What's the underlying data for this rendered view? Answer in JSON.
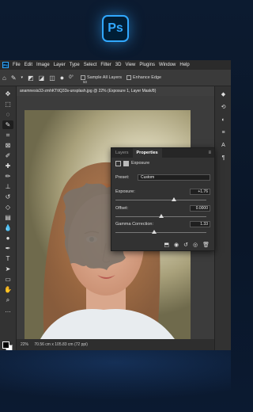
{
  "badge": {
    "logo_text": "Ps"
  },
  "menubar": {
    "logo_text": "Ps",
    "items": [
      "File",
      "Edit",
      "Image",
      "Layer",
      "Type",
      "Select",
      "Filter",
      "3D",
      "View",
      "Plugins",
      "Window",
      "Help"
    ]
  },
  "options": {
    "brush_size": "50",
    "angle": "0°",
    "sample_all_layers": "Sample All Layers",
    "enhance_edge": "Enhance Edge"
  },
  "document": {
    "tab_title": "anamnesis33-zmhKTtIQ33s-unsplash.jpg @ 22% (Exposure 1, Layer Mask/8)",
    "zoom": "22%",
    "dimensions": "70.56 cm x 105.83 cm (72 ppi)"
  },
  "panel": {
    "tabs": [
      "Layers",
      "Properties"
    ],
    "active_tab": "Properties",
    "adjustment_name": "Exposure",
    "preset_label": "Preset:",
    "preset_value": "Custom",
    "exposure_label": "Exposure:",
    "exposure_value": "+1.76",
    "exposure_level": 0.64,
    "offset_label": "Offset:",
    "offset_value": "0.0000",
    "offset_level": 0.5,
    "gamma_label": "Gamma Correction:",
    "gamma_value": "1.33",
    "gamma_level": 0.43
  },
  "colors": {
    "accent": "#31a8ff",
    "ps_dark": "#001e36"
  }
}
